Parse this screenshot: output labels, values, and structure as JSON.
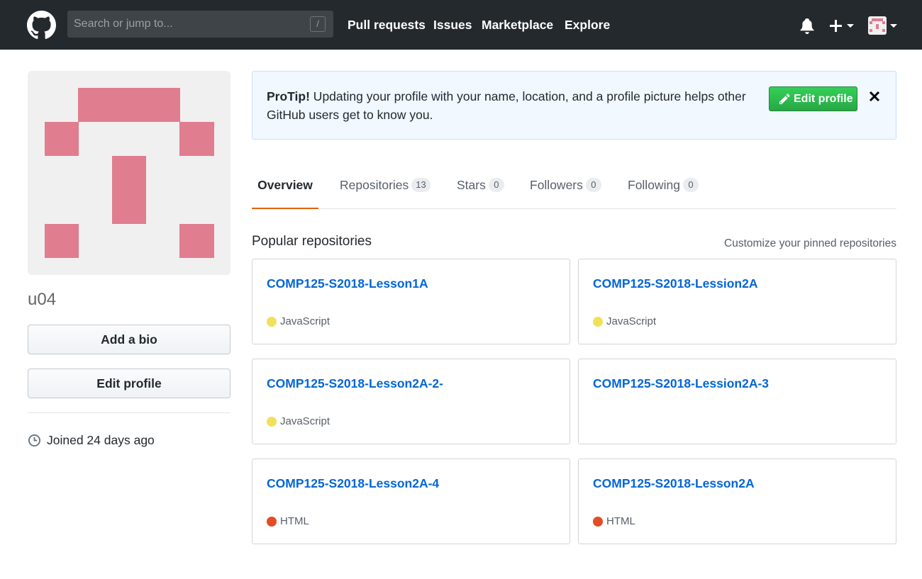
{
  "header": {
    "search_placeholder": "Search or jump to...",
    "slash_hint": "/",
    "nav": [
      "Pull requests",
      "Issues",
      "Marketplace",
      "Explore"
    ],
    "icons": [
      "github-logo-icon",
      "bell-icon",
      "plus-icon",
      "avatar-icon",
      "caret-down-icon"
    ]
  },
  "sidebar": {
    "username": "u04",
    "add_bio": "Add a bio",
    "edit_profile": "Edit profile",
    "joined": "Joined 24 days ago",
    "identicon_color": "#e07d8f"
  },
  "protip": {
    "title": "ProTip!",
    "text": " Updating your profile with your name, location, and a profile picture helps other GitHub users get to know you.",
    "button": "Edit profile",
    "close": "✕"
  },
  "tabs": [
    {
      "label": "Overview",
      "count": null,
      "selected": true
    },
    {
      "label": "Repositories",
      "count": "13",
      "selected": false
    },
    {
      "label": "Stars",
      "count": "0",
      "selected": false
    },
    {
      "label": "Followers",
      "count": "0",
      "selected": false
    },
    {
      "label": "Following",
      "count": "0",
      "selected": false
    }
  ],
  "popular": {
    "title": "Popular repositories",
    "customize": "Customize your pinned repositories",
    "repos": [
      {
        "name": "COMP125-S2018-Lesson1A",
        "language": "JavaScript",
        "color": "#f1e05a"
      },
      {
        "name": "COMP125-S2018-Lession2A",
        "language": "JavaScript",
        "color": "#f1e05a"
      },
      {
        "name": "COMP125-S2018-Lesson2A-2-",
        "language": "JavaScript",
        "color": "#f1e05a"
      },
      {
        "name": "COMP125-S2018-Lession2A-3",
        "language": "",
        "color": ""
      },
      {
        "name": "COMP125-S2018-Lesson2A-4",
        "language": "HTML",
        "color": "#e34c26"
      },
      {
        "name": "COMP125-S2018-Lesson2A",
        "language": "HTML",
        "color": "#e34c26"
      }
    ]
  }
}
